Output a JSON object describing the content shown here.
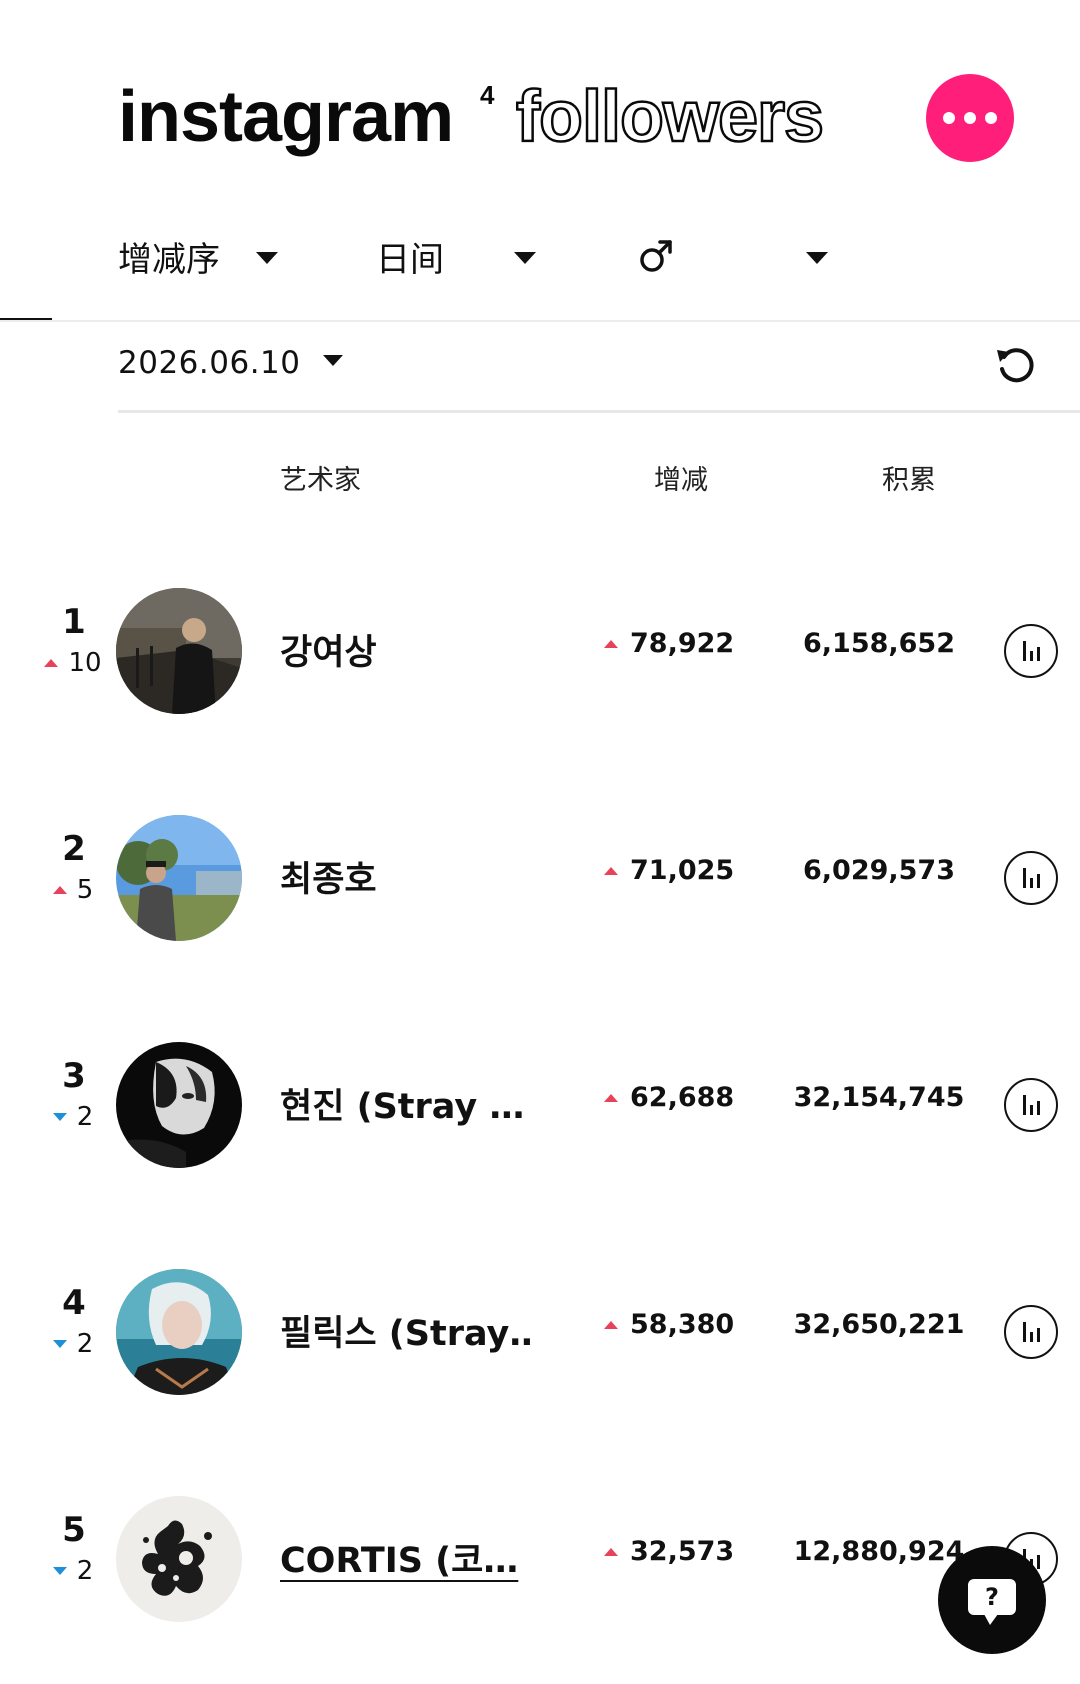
{
  "header": {
    "logo_bold": "instagram",
    "logo_superscript": "4",
    "logo_outline": "followers",
    "more_icon": "more-dots-icon",
    "accent_color": "#ff1f7a"
  },
  "filters": {
    "sort": "增减序",
    "period": "日间",
    "gender_symbol": "♂",
    "gender_icon": "male-symbol-icon"
  },
  "date": {
    "value": "2026.06.10",
    "refresh_icon": "refresh-icon"
  },
  "columns": {
    "artist": "艺术家",
    "change": "增减",
    "total": "积累"
  },
  "rows": [
    {
      "rank": "1",
      "rank_direction": "up",
      "rank_change": "10",
      "avatar": "avatar-photo",
      "name": "강여상",
      "change": "78,922",
      "total": "6,158,652"
    },
    {
      "rank": "2",
      "rank_direction": "up",
      "rank_change": "5",
      "avatar": "avatar-photo",
      "name": "최종호",
      "change": "71,025",
      "total": "6,029,573"
    },
    {
      "rank": "3",
      "rank_direction": "down",
      "rank_change": "2",
      "avatar": "avatar-photo",
      "name": "현진 (Stray …",
      "change": "62,688",
      "total": "32,154,745"
    },
    {
      "rank": "4",
      "rank_direction": "down",
      "rank_change": "2",
      "avatar": "avatar-photo",
      "name": "필릭스 (Stray…",
      "change": "58,380",
      "total": "32,650,221"
    },
    {
      "rank": "5",
      "rank_direction": "down",
      "rank_change": "2",
      "avatar": "avatar-logo",
      "name": "CORTIS (코…",
      "change": "32,573",
      "total": "12,880,924"
    }
  ],
  "colors": {
    "up": "#e8425a",
    "down": "#1e90d8"
  },
  "help": {
    "label": "?",
    "icon": "help-chat-icon"
  }
}
